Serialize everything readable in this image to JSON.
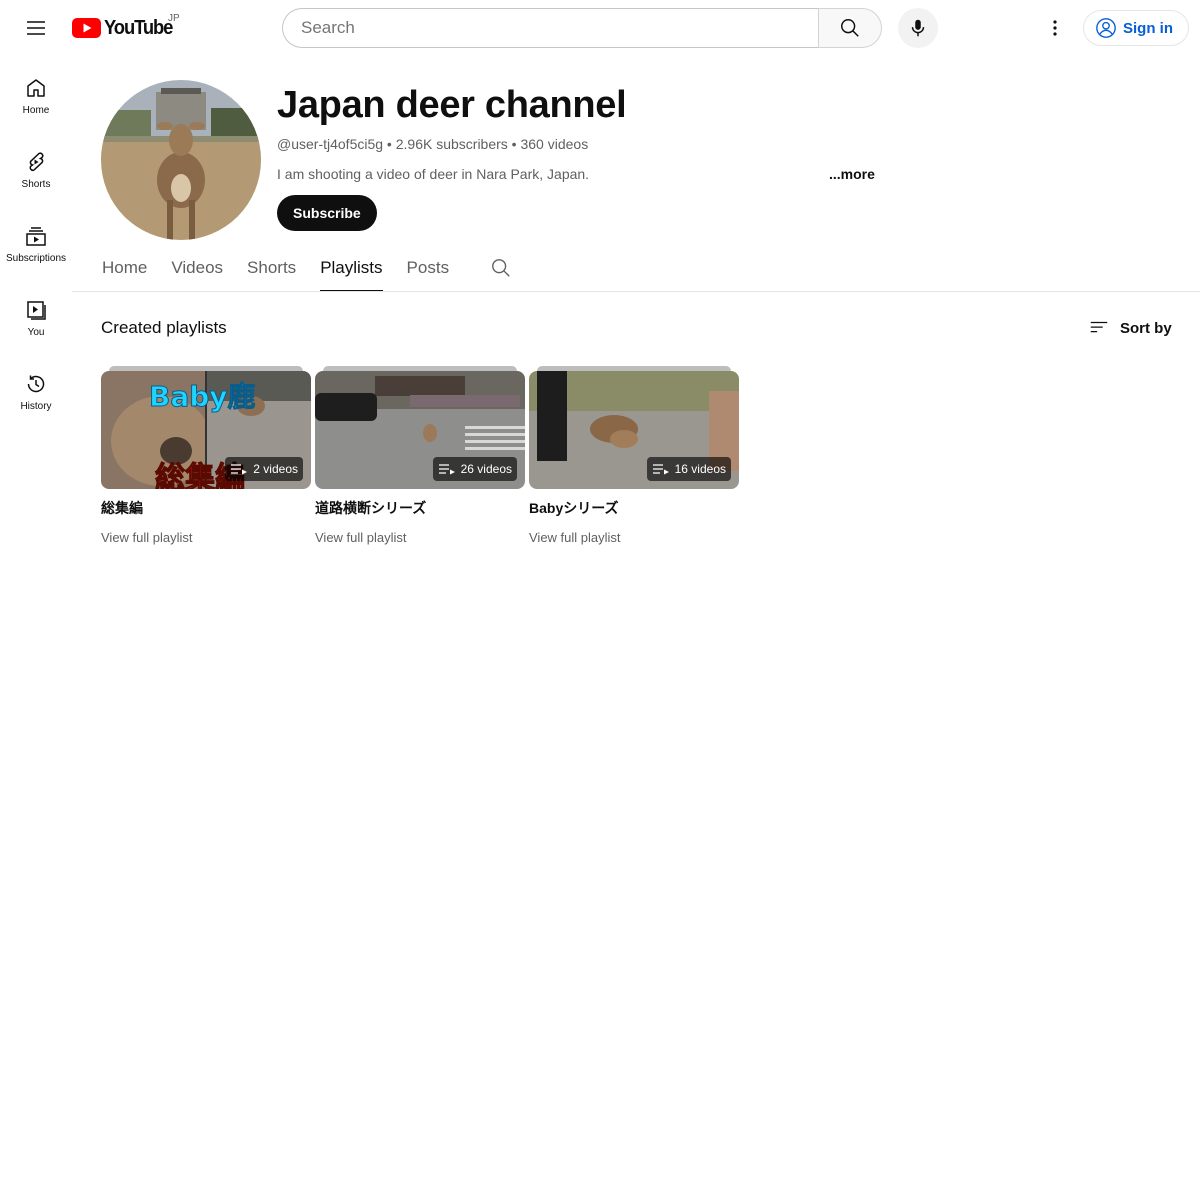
{
  "topbar": {
    "logo_text": "YouTube",
    "logo_country": "JP",
    "search_placeholder": "Search",
    "signin_label": "Sign in"
  },
  "guide": {
    "items": [
      {
        "label": "Home",
        "icon": "home-icon"
      },
      {
        "label": "Shorts",
        "icon": "shorts-icon"
      },
      {
        "label": "Subscriptions",
        "icon": "subscriptions-icon"
      },
      {
        "label": "You",
        "icon": "you-icon"
      },
      {
        "label": "History",
        "icon": "history-icon"
      }
    ]
  },
  "channel": {
    "title": "Japan deer channel",
    "handle": "@user-tj4of5ci5g",
    "subscribers": "2.96K subscribers",
    "videos": "360 videos",
    "description": "I am shooting a video of deer in Nara Park, Japan.",
    "more_label": "...more",
    "subscribe_label": "Subscribe"
  },
  "tabs": [
    {
      "label": "Home",
      "active": false
    },
    {
      "label": "Videos",
      "active": false
    },
    {
      "label": "Shorts",
      "active": false
    },
    {
      "label": "Playlists",
      "active": true
    },
    {
      "label": "Posts",
      "active": false
    }
  ],
  "playlists_section": {
    "title": "Created playlists",
    "sort_label": "Sort by",
    "view_full_label": "View full playlist",
    "items": [
      {
        "title": "総集編",
        "count": "2 videos",
        "thumb_text_top": "Baby鹿",
        "thumb_text_bottom": "総集編"
      },
      {
        "title": "道路横断シリーズ",
        "count": "26 videos"
      },
      {
        "title": "Babyシリーズ",
        "count": "16 videos"
      }
    ]
  },
  "colors": {
    "brand_red": "#ff0000",
    "link_blue": "#065fd4",
    "text_primary": "#0f0f0f",
    "text_secondary": "#606060"
  }
}
